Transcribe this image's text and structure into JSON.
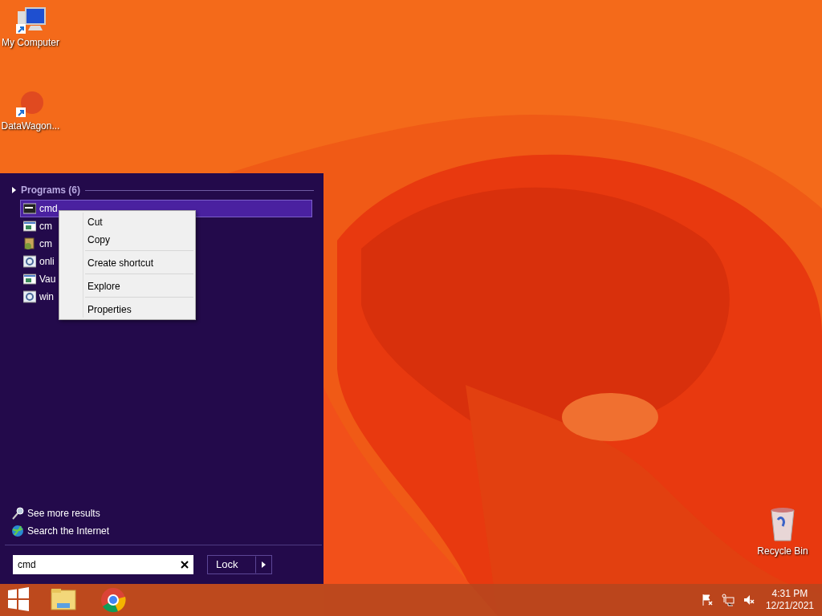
{
  "desktop_icons": [
    {
      "kind": "computer",
      "label": "My Computer"
    },
    {
      "kind": "app",
      "label": "DataWagon..."
    }
  ],
  "recycle_bin": {
    "label": "Recycle Bin"
  },
  "start_menu": {
    "group": {
      "label": "Programs (6)",
      "expanded": false
    },
    "programs": [
      {
        "kind": "console",
        "label": "cmd",
        "selected": true
      },
      {
        "kind": "window",
        "label": "cm",
        "selected": false
      },
      {
        "kind": "installer",
        "label": "cm",
        "selected": false
      },
      {
        "kind": "gear",
        "label": "onli",
        "selected": false
      },
      {
        "kind": "window",
        "label": "Vau",
        "selected": false
      },
      {
        "kind": "gear",
        "label": "win",
        "selected": false
      }
    ],
    "links": [
      {
        "kind": "search",
        "label": "See more results"
      },
      {
        "kind": "globe",
        "label": "Search the Internet"
      }
    ],
    "search": {
      "value": "cmd"
    },
    "power_button": {
      "label": "Lock"
    }
  },
  "context_menu": [
    [
      {
        "label": "Cut"
      },
      {
        "label": "Copy"
      }
    ],
    [
      {
        "label": "Create shortcut"
      }
    ],
    [
      {
        "label": "Explore"
      }
    ],
    [
      {
        "label": "Properties"
      }
    ]
  ],
  "taskbar": {
    "apps": [
      {
        "kind": "start"
      },
      {
        "kind": "folder"
      },
      {
        "kind": "browser"
      }
    ],
    "tray": [
      {
        "kind": "flag"
      },
      {
        "kind": "network"
      },
      {
        "kind": "volume"
      }
    ],
    "time": "4:31 PM",
    "date": "12/21/2021"
  }
}
